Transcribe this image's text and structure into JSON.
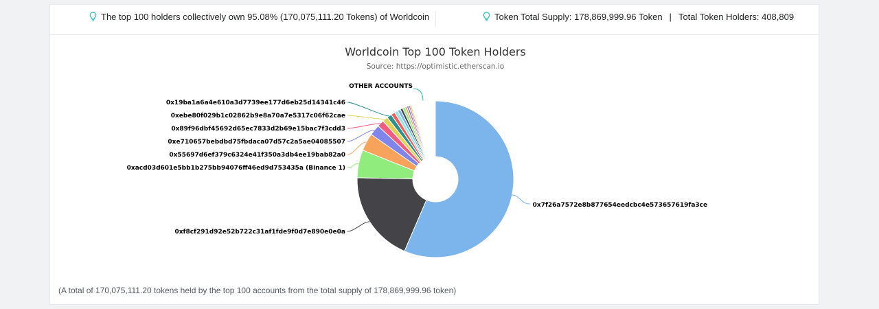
{
  "header": {
    "holders_share_text": "The top 100 holders collectively own 95.08% (170,075,111.20 Tokens) of Worldcoin",
    "total_supply_text": "Token Total Supply: 178,869,999.96 Token",
    "separator": "|",
    "total_holders_text": "Total Token Holders: 408,809"
  },
  "footnote": "(A total of 170,075,111.20 tokens held by the top 100 accounts from the total supply of 178,869,999.96 token)",
  "colors": {
    "accent_icon": "#29c0b6",
    "card_bg": "#ffffff",
    "page_bg": "#f1f2f4"
  },
  "chart_data": {
    "type": "pie",
    "variant": "donut",
    "title": "Worldcoin Top 100 Token Holders",
    "subtitle": "Source: https://optimistic.etherscan.io",
    "unit": "percent of total supply (estimated)",
    "slices": [
      {
        "label": "0x7f26a7572e8b877654eedcbc4e573657619fa3ce",
        "value": 55.8,
        "color": "#7cb5ec"
      },
      {
        "label": "0xf8cf291d92e52b722c31af1fde9f0d7e890e0e0a",
        "value": 18.6,
        "color": "#434348"
      },
      {
        "label": "0xacd03d601e5bb1b275bb94076ff46ed9d753435a (Binance 1)",
        "value": 5.7,
        "color": "#90ed7d"
      },
      {
        "label": "0x55697d6ef379c6324e41f350a3db4ee19bab82a0",
        "value": 3.6,
        "color": "#f7a35c"
      },
      {
        "label": "0xe710657bebdbd75fbdaca07d57c2a5ae04085507",
        "value": 2.2,
        "color": "#8085e9"
      },
      {
        "label": "0x89f96dbf45692d65ec7833d2b69e15bac7f3cdd3",
        "value": 1.4,
        "color": "#f15c80"
      },
      {
        "label": "0xebe80f029b1c02862b9e8a70a7e5317c06f62cae",
        "value": 1.1,
        "color": "#e4d354"
      },
      {
        "label": "0x19ba1a6a4e610a3d7739ee177d6eb25d14341c46",
        "value": 1.0,
        "color": "#2b908f"
      },
      {
        "label": "",
        "value": 0.8,
        "color": "#f45b5b"
      },
      {
        "label": "",
        "value": 0.7,
        "color": "#91e8e1"
      },
      {
        "label": "",
        "value": 0.6,
        "color": "#7cb5ec"
      },
      {
        "label": "",
        "value": 0.5,
        "color": "#434348"
      },
      {
        "label": "",
        "value": 0.5,
        "color": "#90ed7d"
      },
      {
        "label": "",
        "value": 0.4,
        "color": "#f7a35c"
      },
      {
        "label": "",
        "value": 0.4,
        "color": "#8085e9"
      },
      {
        "label": "",
        "value": 0.3,
        "color": "#f15c80"
      },
      {
        "label": "",
        "value": 0.3,
        "color": "#e4d354"
      },
      {
        "label": "OTHER ACCOUNTS",
        "value": 4.92,
        "color": "#ffffff"
      }
    ],
    "legend": "none"
  }
}
